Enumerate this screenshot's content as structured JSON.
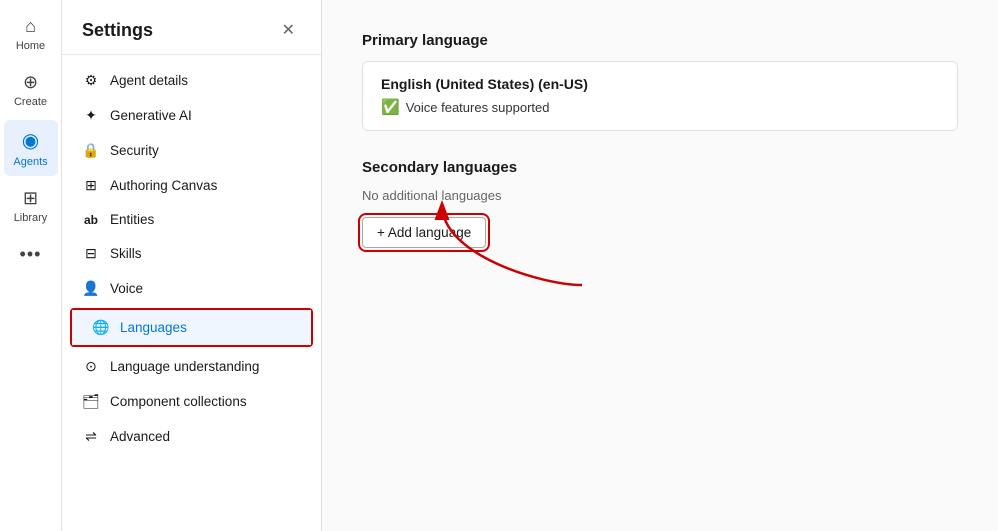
{
  "app": {
    "title": "Settings",
    "close_label": "✕"
  },
  "nav": {
    "items": [
      {
        "id": "home",
        "label": "Home",
        "icon": "⌂",
        "active": false
      },
      {
        "id": "create",
        "label": "Create",
        "icon": "⊕",
        "active": false
      },
      {
        "id": "agents",
        "label": "Agents",
        "icon": "◉",
        "active": true
      },
      {
        "id": "library",
        "label": "Library",
        "icon": "⊞",
        "active": false
      },
      {
        "id": "more",
        "label": "...",
        "icon": "···",
        "active": false
      }
    ]
  },
  "sidebar": {
    "items": [
      {
        "id": "agent-details",
        "label": "Agent details",
        "icon": "⚙",
        "active": false
      },
      {
        "id": "generative-ai",
        "label": "Generative AI",
        "icon": "✦",
        "active": false
      },
      {
        "id": "security",
        "label": "Security",
        "icon": "🔒",
        "active": false
      },
      {
        "id": "authoring-canvas",
        "label": "Authoring Canvas",
        "icon": "⊞",
        "active": false
      },
      {
        "id": "entities",
        "label": "Entities",
        "icon": "ab",
        "active": false
      },
      {
        "id": "skills",
        "label": "Skills",
        "icon": "⊟",
        "active": false
      },
      {
        "id": "voice",
        "label": "Voice",
        "icon": "👤",
        "active": false
      },
      {
        "id": "languages",
        "label": "Languages",
        "icon": "🌐",
        "active": true
      },
      {
        "id": "language-understanding",
        "label": "Language understanding",
        "icon": "⊙",
        "active": false
      },
      {
        "id": "component-collections",
        "label": "Component collections",
        "icon": "🗂",
        "active": false
      },
      {
        "id": "advanced",
        "label": "Advanced",
        "icon": "⇌",
        "active": false
      }
    ]
  },
  "main": {
    "primary_language": {
      "section_title": "Primary language",
      "lang_name": "English (United States) (en-US)",
      "voice_label": "Voice features supported"
    },
    "secondary_language": {
      "section_title": "Secondary languages",
      "no_lang_text": "No additional languages",
      "add_button_label": "+ Add language"
    }
  }
}
